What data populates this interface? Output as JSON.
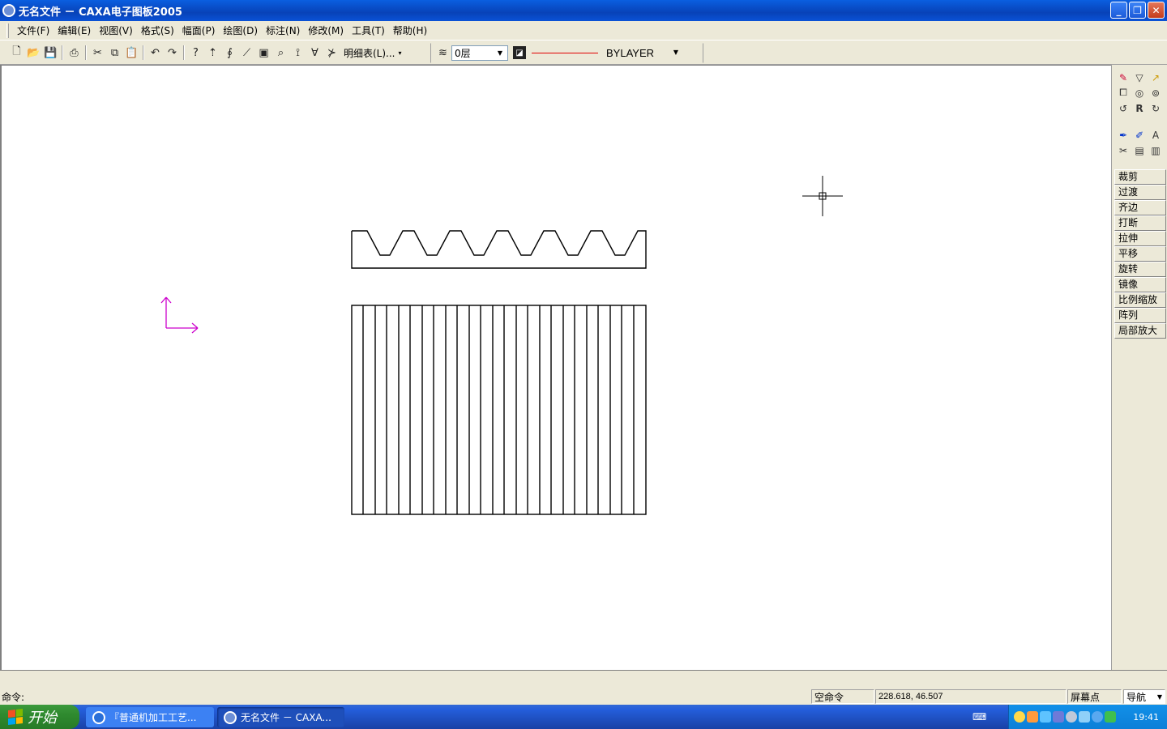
{
  "window": {
    "title": "无名文件 － CAXA电子图板2005",
    "buttons": {
      "minimize": "_",
      "restore": "❐",
      "close": "✕"
    }
  },
  "menu": [
    "文件(F)",
    "编辑(E)",
    "视图(V)",
    "格式(S)",
    "幅面(P)",
    "绘图(D)",
    "标注(N)",
    "修改(M)",
    "工具(T)",
    "帮助(H)"
  ],
  "toolbar": {
    "bom_label": "明细表(L)...",
    "layer_value": "0层",
    "linetype_value": "BYLAYER",
    "line_color": "#e00000"
  },
  "right_panel": {
    "commands": [
      "裁剪",
      "过渡",
      "齐边",
      "打断",
      "拉伸",
      "平移",
      "旋转",
      "镜像",
      "比例缩放",
      "阵列",
      "局部放大"
    ]
  },
  "status": {
    "prompt": "命令:",
    "command_state": "空命令",
    "coordinates": "228.618, 46.507",
    "snap_mode": "屏幕点",
    "nav_mode": "导航"
  },
  "taskbar": {
    "start_label": "开始",
    "tasks": [
      "『普通机加工工艺...",
      "无名文件 － CAXA..."
    ],
    "clock": "19:41"
  },
  "colors": {
    "axis_marker": "#cc00cc",
    "drawing_lines": "#000000",
    "titlebar": "#0a5fe0"
  }
}
